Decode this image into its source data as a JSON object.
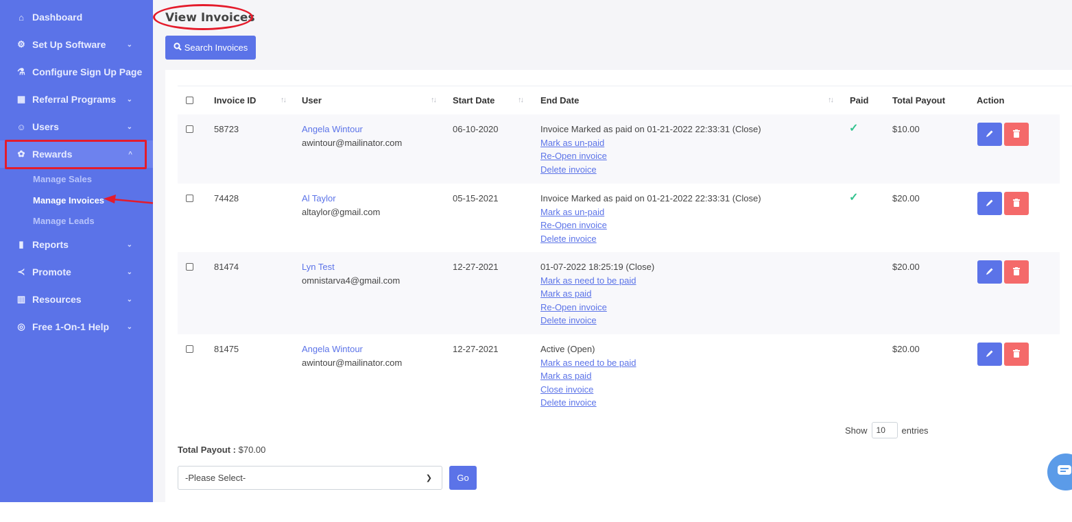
{
  "sidebar": {
    "items": [
      {
        "label": "Dashboard",
        "icon": "home-icon",
        "glyph": "⌂",
        "chevron": false
      },
      {
        "label": "Set Up Software",
        "icon": "gear-icon",
        "glyph": "⚙",
        "chevron": true
      },
      {
        "label": "Configure Sign Up Page",
        "icon": "flask-icon",
        "glyph": "⚗",
        "chevron": false
      },
      {
        "label": "Referral Programs",
        "icon": "store-icon",
        "glyph": "▦",
        "chevron": true
      },
      {
        "label": "Users",
        "icon": "user-icon",
        "glyph": "☺",
        "chevron": true
      },
      {
        "label": "Rewards",
        "icon": "gift-icon",
        "glyph": "✿",
        "chevron": true,
        "active": true
      },
      {
        "label": "Reports",
        "icon": "bar-chart-icon",
        "glyph": "▮",
        "chevron": true
      },
      {
        "label": "Promote",
        "icon": "share-icon",
        "glyph": "≺",
        "chevron": true
      },
      {
        "label": "Resources",
        "icon": "bank-icon",
        "glyph": "▥",
        "chevron": true
      },
      {
        "label": "Free 1-On-1 Help",
        "icon": "lifebuoy-icon",
        "glyph": "◎",
        "chevron": true
      }
    ],
    "rewards_sub": [
      "Manage Sales",
      "Manage Invoices",
      "Manage Leads"
    ],
    "current_sub": "Manage Invoices"
  },
  "page": {
    "title": "View Invoices",
    "search_button": "Search Invoices"
  },
  "table": {
    "headers": [
      "Invoice ID",
      "User",
      "Start Date",
      "End Date",
      "Paid",
      "Total Payout",
      "Action"
    ],
    "rows": [
      {
        "invoice_id": "58723",
        "user_name": "Angela Wintour",
        "user_email": "awintour@mailinator.com",
        "start_date": "06-10-2020",
        "end_status": "Invoice Marked as paid on 01-21-2022 22:33:31 (Close)",
        "actions": [
          "Mark as un-paid",
          "Re-Open invoice",
          "Delete invoice"
        ],
        "paid": true,
        "total_payout": "$10.00"
      },
      {
        "invoice_id": "74428",
        "user_name": "Al Taylor",
        "user_email": "altaylor@gmail.com",
        "start_date": "05-15-2021",
        "end_status": "Invoice Marked as paid on 01-21-2022 22:33:31 (Close)",
        "actions": [
          "Mark as un-paid",
          "Re-Open invoice",
          "Delete invoice"
        ],
        "paid": true,
        "total_payout": "$20.00"
      },
      {
        "invoice_id": "81474",
        "user_name": "Lyn Test",
        "user_email": "omnistarva4@gmail.com",
        "start_date": "12-27-2021",
        "end_status": "01-07-2022 18:25:19 (Close)",
        "actions": [
          "Mark as need to be paid",
          "Mark as paid",
          "Re-Open invoice",
          "Delete invoice"
        ],
        "paid": false,
        "total_payout": "$20.00"
      },
      {
        "invoice_id": "81475",
        "user_name": "Angela Wintour",
        "user_email": "awintour@mailinator.com",
        "start_date": "12-27-2021",
        "end_status": "Active (Open)",
        "actions": [
          "Mark as need to be paid",
          "Mark as paid",
          "Close invoice",
          "Delete invoice"
        ],
        "paid": false,
        "total_payout": "$20.00"
      }
    ]
  },
  "footer": {
    "show_label": "Show",
    "entries_value": "10",
    "entries_label": "entries",
    "total_label": "Total Payout :",
    "total_value": "$70.00",
    "select_value": "-Please Select-",
    "go_label": "Go"
  },
  "colors": {
    "sidebar": "#5b73e8",
    "accent": "#5b73e8",
    "danger": "#f46a6a",
    "success": "#34c38f",
    "annotation": "#e41b2b"
  }
}
